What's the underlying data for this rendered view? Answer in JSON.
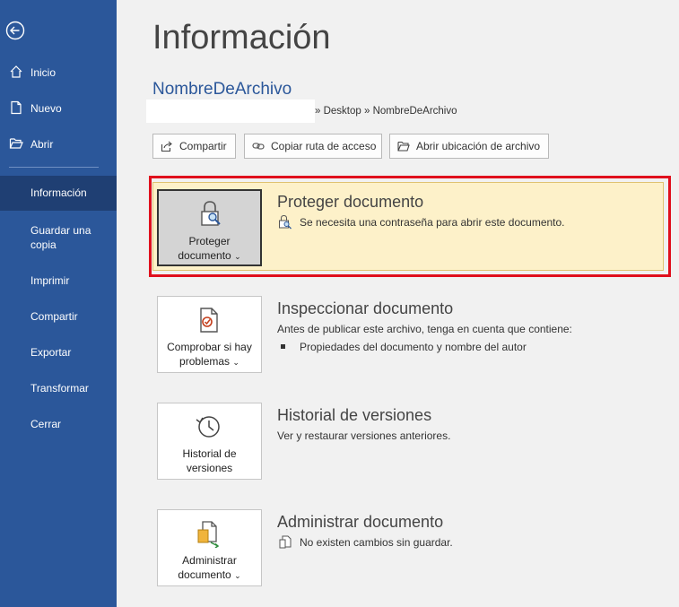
{
  "sidebar": {
    "items": [
      {
        "label": "Inicio",
        "icon": "home-icon"
      },
      {
        "label": "Nuevo",
        "icon": "new-document-icon"
      },
      {
        "label": "Abrir",
        "icon": "open-folder-icon"
      },
      {
        "label": "Información"
      },
      {
        "label": "Guardar una copia"
      },
      {
        "label": "Imprimir"
      },
      {
        "label": "Compartir"
      },
      {
        "label": "Exportar"
      },
      {
        "label": "Transformar"
      },
      {
        "label": "Cerrar"
      }
    ],
    "selected": "Información",
    "back_icon": "back-arrow-icon"
  },
  "main": {
    "title": "Información",
    "filename": "NombreDeArchivo",
    "path": "» Desktop » NombreDeArchivo",
    "buttons": [
      {
        "label": "Compartir",
        "icon": "share-icon"
      },
      {
        "label": "Copiar ruta de acceso",
        "icon": "link-icon"
      },
      {
        "label": "Abrir ubicación de archivo",
        "icon": "folder-icon"
      }
    ],
    "sections": [
      {
        "tile_line1": "Proteger",
        "tile_line2": "documento",
        "tile_icon": "lock-icon",
        "title": "Proteger documento",
        "desc": "Se necesita una contraseña para abrir este documento."
      },
      {
        "tile_line1": "Comprobar si hay",
        "tile_line2": "problemas",
        "tile_icon": "inspect-icon",
        "title": "Inspeccionar documento",
        "desc": "Antes de publicar este archivo, tenga en cuenta que contiene:",
        "bullet": "Propiedades del documento y nombre del autor"
      },
      {
        "tile_line1": "Historial de",
        "tile_line2": "versiones",
        "tile_icon": "history-icon",
        "title": "Historial de versiones",
        "desc": "Ver y restaurar versiones anteriores."
      },
      {
        "tile_line1": "Administrar",
        "tile_line2": "documento",
        "tile_icon": "manage-document-icon",
        "title": "Administrar documento",
        "desc": "No existen cambios sin guardar."
      }
    ]
  },
  "colors": {
    "sidebar": "#2b579a",
    "sidebar_selected": "#1f3f73",
    "highlight": "#e0101d",
    "protect_bg": "#fdf1c9"
  }
}
